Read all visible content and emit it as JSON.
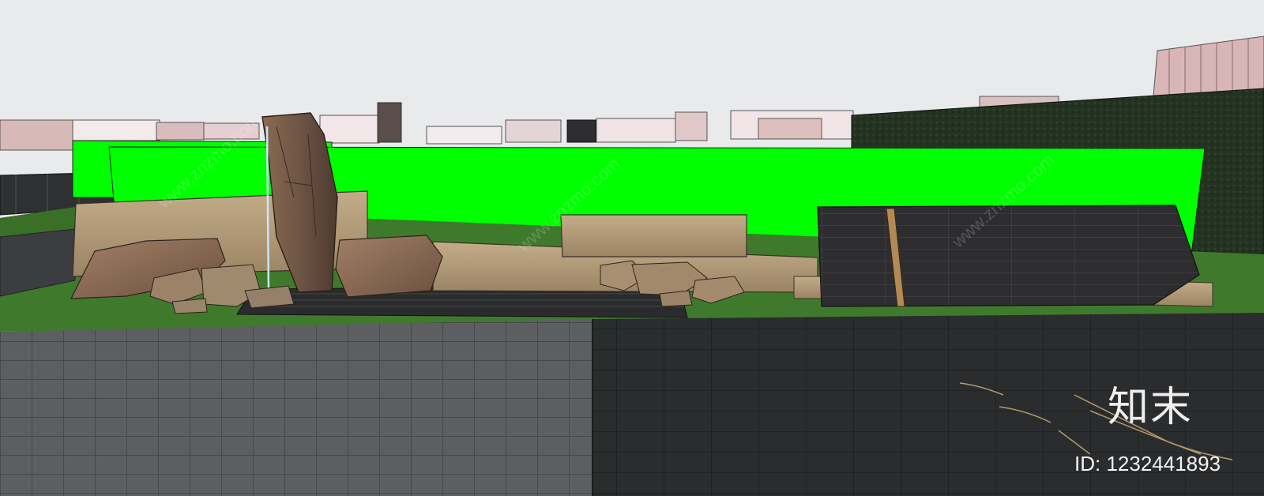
{
  "watermark": {
    "logo_text": "知末",
    "id_text": "ID: 1232441893",
    "diagonal_text": "www.znzmo.com"
  },
  "colors": {
    "sky": "#e9eaec",
    "screen_green": "#00ff00",
    "lawn": "#3f7a2c",
    "paving_light": "#5c5d60",
    "paving_dark": "#2a2b2d",
    "stone": "#b09a78",
    "hedge": "#23331f",
    "slate_wall": "#2b2b2d"
  }
}
